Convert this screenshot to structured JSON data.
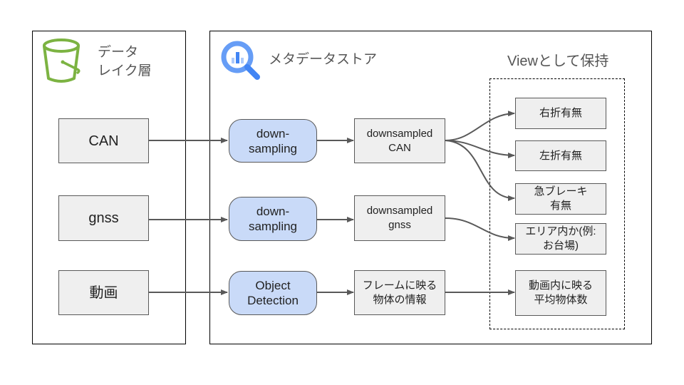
{
  "data_lake": {
    "title": "データ\nレイク層",
    "icon": "bucket-icon",
    "icon_color": "#7cb342",
    "sources": [
      "CAN",
      "gnss",
      "動画"
    ]
  },
  "metadata_store": {
    "title": "メタデータストア",
    "icon": "bigquery-icon",
    "icon_color": "#4285f4",
    "processes": [
      "down-\nsampling",
      "down-\nsampling",
      "Object\nDetection"
    ],
    "outputs": [
      "downsampled\nCAN",
      "downsampled\ngnss",
      "フレームに映る\n物体の情報"
    ]
  },
  "views": {
    "title": "Viewとして保持",
    "items": [
      "右折有無",
      "左折有無",
      "急ブレーキ\n有無",
      "エリア内か(例:\nお台場)",
      "動画内に映る\n平均物体数"
    ]
  },
  "colors": {
    "process_fill": "#c9daf8",
    "box_fill": "#efefef",
    "arrow": "#595959"
  }
}
